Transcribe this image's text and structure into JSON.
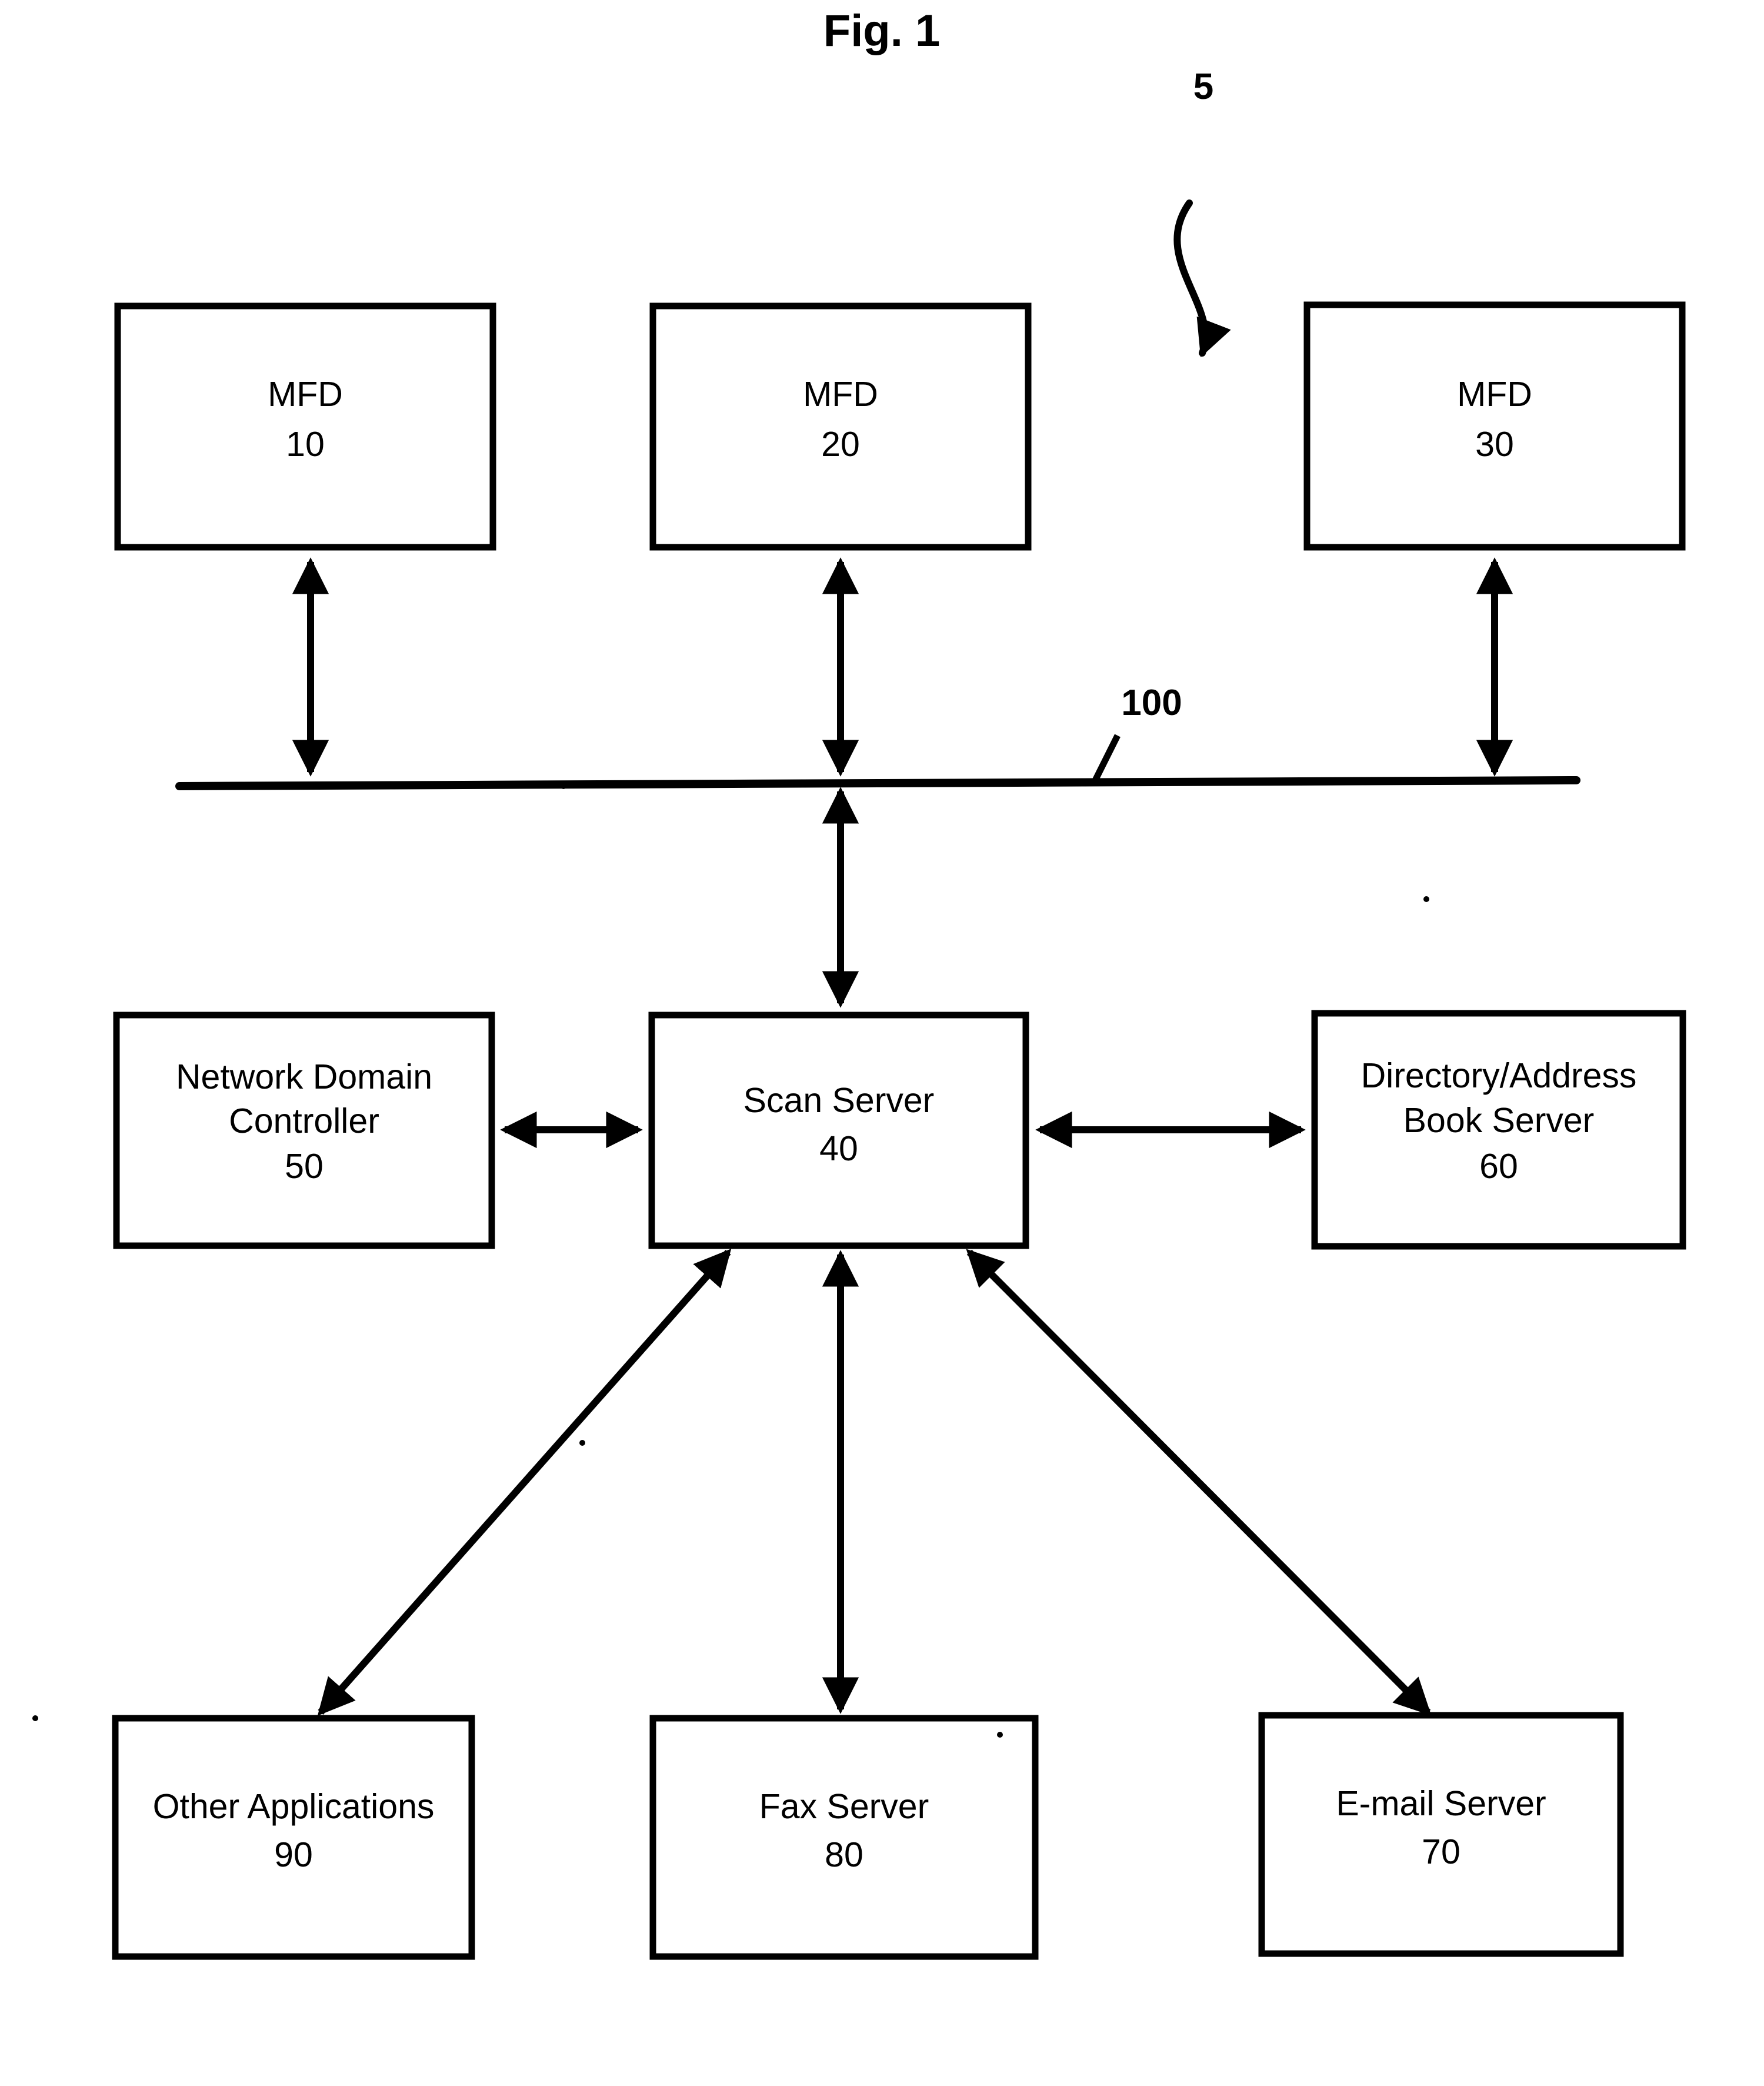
{
  "figure": {
    "title": "Fig. 1",
    "system_reference": "5",
    "network_reference": "100"
  },
  "nodes": {
    "mfd_10": {
      "name": "MFD",
      "ref": "10"
    },
    "mfd_20": {
      "name": "MFD",
      "ref": "20"
    },
    "mfd_30": {
      "name": "MFD",
      "ref": "30"
    },
    "network_domain_controller": {
      "line1": "Network Domain",
      "line2": "Controller",
      "ref": "50"
    },
    "scan_server": {
      "name": "Scan Server",
      "ref": "40"
    },
    "directory_address_book_server": {
      "line1": "Directory/Address",
      "line2": "Book Server",
      "ref": "60"
    },
    "other_applications": {
      "name": "Other Applications",
      "ref": "90"
    },
    "fax_server": {
      "name": "Fax Server",
      "ref": "80"
    },
    "email_server": {
      "name": "E-mail Server",
      "ref": "70"
    }
  },
  "colors": {
    "ink": "#000000",
    "paper": "#ffffff"
  }
}
